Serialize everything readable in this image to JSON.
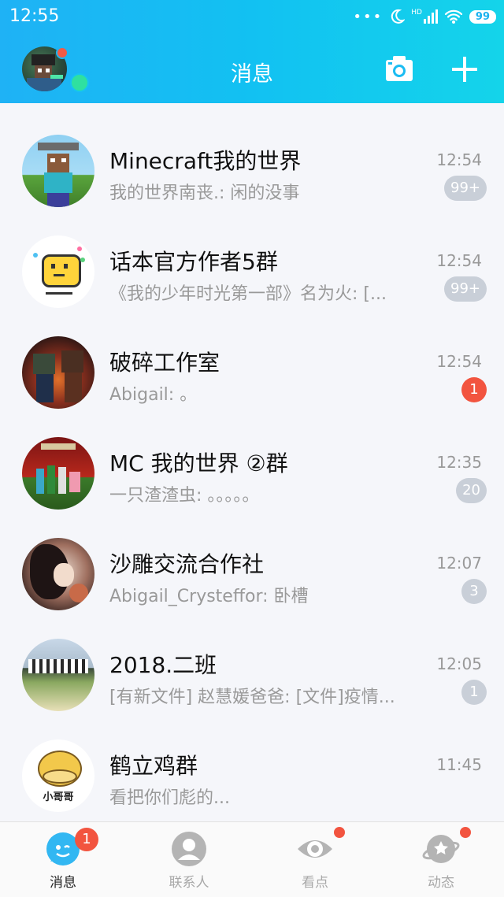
{
  "status_bar": {
    "time": "12:55",
    "signal": "HD",
    "battery": "99"
  },
  "header": {
    "title": "消息"
  },
  "conversations": [
    {
      "name": "Minecraft我的世界",
      "preview": "我的世界南丧.: 闲的没事",
      "time": "12:54",
      "badge": "99+",
      "badge_color": "#c9cfd8"
    },
    {
      "name": "话本官方作者5群",
      "preview": "《我的少年时光第一部》名为火: [...",
      "time": "12:54",
      "badge": "99+",
      "badge_color": "#c9cfd8"
    },
    {
      "name": "破碎工作室",
      "preview": "Abigail: 。",
      "time": "12:54",
      "badge": "1",
      "badge_color": "#f2543f"
    },
    {
      "name": "MC 我的世界 ②群",
      "preview": "一只渣渣虫: 。。。。。",
      "time": "12:35",
      "badge": "20",
      "badge_color": "#c9cfd8"
    },
    {
      "name": "沙雕交流合作社",
      "preview": "Abigail_Crysteffor: 卧槽",
      "time": "12:07",
      "badge": "3",
      "badge_color": "#c9cfd8"
    },
    {
      "name": "2018.二班",
      "preview": "[有新文件] 赵慧媛爸爸: [文件]疫情...",
      "time": "12:05",
      "badge": "1",
      "badge_color": "#c9cfd8"
    },
    {
      "name": "鹤立鸡群",
      "preview": "看把你们彪的...",
      "time": "11:45",
      "badge": "",
      "badge_color": ""
    }
  ],
  "avatar_text": {
    "psyduck": "小哥哥"
  },
  "tabs": [
    {
      "label": "消息",
      "icon": "chat-bubble-icon",
      "badge": "1"
    },
    {
      "label": "联系人",
      "icon": "contacts-person-icon"
    },
    {
      "label": "看点",
      "icon": "eye-icon"
    },
    {
      "label": "动态",
      "icon": "planet-star-icon"
    }
  ],
  "colors": {
    "header_start": "#1fb2f5",
    "header_end": "#14d4ea",
    "badge_red": "#f2543f",
    "badge_gray": "#c9cfd8"
  }
}
